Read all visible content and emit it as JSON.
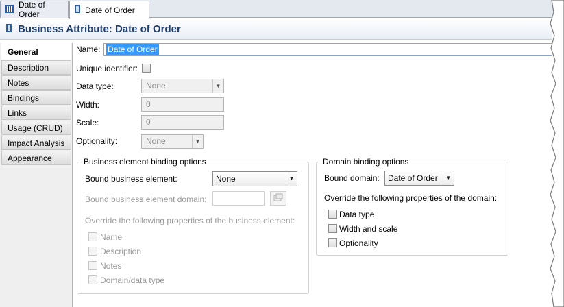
{
  "tabs": [
    {
      "label": "Date of Order",
      "icon": "model-icon"
    },
    {
      "label": "Date of Order",
      "icon": "attribute-icon"
    }
  ],
  "editor": {
    "title": "Business Attribute: Date of Order",
    "icon": "attribute-icon"
  },
  "sidebar": {
    "items": [
      {
        "label": "General"
      },
      {
        "label": "Description"
      },
      {
        "label": "Notes"
      },
      {
        "label": "Bindings"
      },
      {
        "label": "Links"
      },
      {
        "label": "Usage (CRUD)"
      },
      {
        "label": "Impact Analysis"
      },
      {
        "label": "Appearance"
      }
    ]
  },
  "general": {
    "name_label": "Name:",
    "name_value": "Date of Order",
    "unique_label": "Unique identifier:",
    "datatype_label": "Data type:",
    "datatype_value": "None",
    "width_label": "Width:",
    "width_value": "0",
    "scale_label": "Scale:",
    "scale_value": "0",
    "optionality_label": "Optionality:",
    "optionality_value": "None"
  },
  "business_binding": {
    "title": "Business element binding options",
    "bound_label": "Bound business element:",
    "bound_value": "None",
    "domain_label": "Bound business element domain:",
    "override_label": "Override the following properties of the business element:",
    "options": [
      "Name",
      "Description",
      "Notes",
      "Domain/data type"
    ]
  },
  "domain_binding": {
    "title": "Domain binding options",
    "bound_label": "Bound domain:",
    "bound_value": "Date of Order",
    "override_label": "Override the following properties of the domain:",
    "options": [
      "Data type",
      "Width and scale",
      "Optionality"
    ]
  },
  "colors": {
    "title": "#1f3f6e",
    "selection": "#3399ff",
    "header_bg": "#e9eef6"
  }
}
